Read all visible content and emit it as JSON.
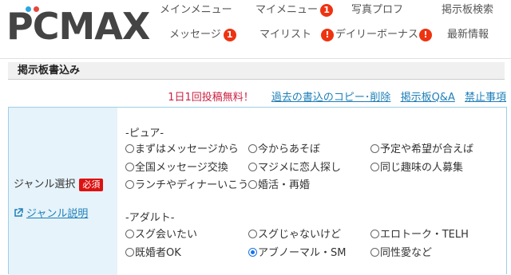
{
  "header": {
    "logo_text": "PCMAX",
    "nav": {
      "main_menu": "メインメニュー",
      "my_menu": "マイメニュー",
      "my_menu_badge": "1",
      "photo_profile": "写真プロフ",
      "board_search": "掲示板検索",
      "message": "メッセージ",
      "message_badge": "1",
      "my_list": "マイリスト",
      "my_list_badge": "!",
      "daily_bonus": "デイリーボーナス",
      "daily_bonus_badge": "!",
      "latest_info": "最新情報"
    }
  },
  "page_title": "掲示板書込み",
  "links": {
    "notice": "1日1回投稿無料！",
    "copy_delete": "過去の書込のコピー･削除",
    "board_qa": "掲示板Q&A",
    "prohibited": "禁止事項"
  },
  "form": {
    "genre_label": "ジャンル選択",
    "required": "必須",
    "genre_help": "ジャンル説明",
    "groups": [
      {
        "title": "-ピュア-",
        "options": [
          {
            "label": "まずはメッセージから",
            "checked": false
          },
          {
            "label": "今からあそぼ",
            "checked": false
          },
          {
            "label": "予定や希望が合えば",
            "checked": false
          },
          {
            "label": "全国メッセージ交換",
            "checked": false
          },
          {
            "label": "マジメに恋人探し",
            "checked": false
          },
          {
            "label": "同じ趣味の人募集",
            "checked": false
          },
          {
            "label": "ランチやディナーいこう",
            "checked": false
          },
          {
            "label": "婚活・再婚",
            "checked": false
          }
        ]
      },
      {
        "title": "-アダルト-",
        "options": [
          {
            "label": "スグ会いたい",
            "checked": false
          },
          {
            "label": "スグじゃないけど",
            "checked": false
          },
          {
            "label": "エロトーク・TELH",
            "checked": false
          },
          {
            "label": "既婚者OK",
            "checked": false
          },
          {
            "label": "アブノーマル・SM",
            "checked": true
          },
          {
            "label": "同性愛など",
            "checked": false
          }
        ]
      }
    ]
  },
  "colors": {
    "accent_link": "#1d7fb8",
    "badge_red": "#ee3311",
    "label_bg": "#e6f3fa",
    "logo_dot_blue": "#2aa6e0",
    "logo_dot_red": "#e8453c"
  }
}
